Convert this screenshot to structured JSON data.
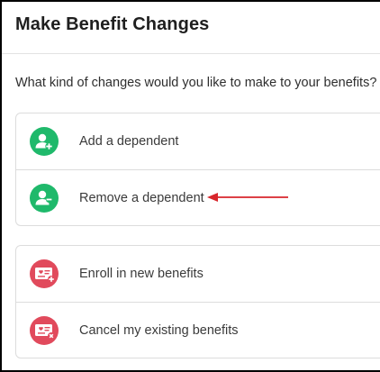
{
  "header": {
    "title": "Make Benefit Changes"
  },
  "prompt": {
    "question": "What kind of changes would you like to make to your benefits?"
  },
  "dependent_options": [
    {
      "label": "Add a dependent",
      "icon": "add-user-icon"
    },
    {
      "label": "Remove a dependent",
      "icon": "remove-user-icon"
    }
  ],
  "benefit_options": [
    {
      "label": "Enroll in new benefits",
      "icon": "benefits-card-add-icon"
    },
    {
      "label": "Cancel my existing benefits",
      "icon": "benefits-card-cancel-icon"
    }
  ],
  "colors": {
    "dependent_icon_bg": "#1fb96b",
    "benefit_icon_bg": "#e14a5c",
    "annotation_arrow": "#d8262c"
  },
  "annotation": {
    "icon": "red-arrow-icon"
  }
}
